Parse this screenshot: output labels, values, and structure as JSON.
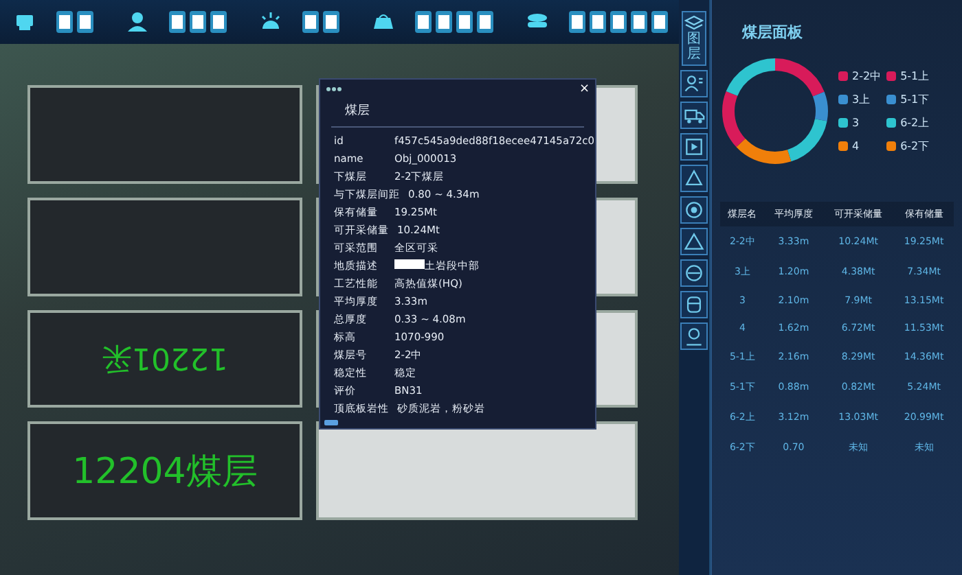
{
  "top_nav": [
    {
      "kind": "monitor"
    },
    {
      "kind": "person"
    },
    {
      "kind": "lamp"
    },
    {
      "kind": "cart"
    },
    {
      "kind": "stack"
    }
  ],
  "scene": {
    "labels": [
      {
        "text": "12204煤层",
        "kind": "large"
      },
      {
        "text": "12201采",
        "kind": "flipped"
      }
    ]
  },
  "side_tabs": {
    "layer_label": "图层"
  },
  "popup": {
    "close": "×",
    "title": "煤层",
    "rows": [
      {
        "key": "id",
        "value": "f457c545a9ded88f18ecee47145a72c0"
      },
      {
        "key": "name",
        "value": "Obj_000013"
      },
      {
        "key": "下煤层",
        "value": "2-2下煤层"
      },
      {
        "key": "与下煤层间距",
        "value": "0.80 ~ 4.34m"
      },
      {
        "key": "保有储量",
        "value": "19.25Mt"
      },
      {
        "key": "可开采储量",
        "value": "10.24Mt"
      },
      {
        "key": "可采范围",
        "value": "全区可采"
      },
      {
        "key": "地质描述",
        "value": "土岩段中部",
        "redacted": true
      },
      {
        "key": "工艺性能",
        "value": "高热值煤(HQ)"
      },
      {
        "key": "平均厚度",
        "value": "3.33m"
      },
      {
        "key": "总厚度",
        "value": "0.33 ~ 4.08m"
      },
      {
        "key": "标高",
        "value": "1070-990"
      },
      {
        "key": "煤层号",
        "value": "2-2中"
      },
      {
        "key": "稳定性",
        "value": "稳定"
      },
      {
        "key": "评价",
        "value": "BN31"
      },
      {
        "key": "顶底板岩性",
        "value": "砂质泥岩，粉砂岩"
      }
    ]
  },
  "panel": {
    "title": "煤层面板",
    "legend": [
      {
        "label": "2-2中",
        "color": "#d81b5a"
      },
      {
        "label": "5-1上",
        "color": "#d81b5a"
      },
      {
        "label": "3上",
        "color": "#3a8fd0"
      },
      {
        "label": "5-1下",
        "color": "#3a8fd0"
      },
      {
        "label": "3",
        "color": "#2ec4cf"
      },
      {
        "label": "6-2上",
        "color": "#2ec4cf"
      },
      {
        "label": "4",
        "color": "#f07f0a"
      },
      {
        "label": "6-2下",
        "color": "#f07f0a"
      }
    ],
    "table": {
      "columns": [
        "煤层名",
        "平均厚度",
        "可开采储量",
        "保有储量"
      ],
      "rows": [
        [
          "2-2中",
          "3.33m",
          "10.24Mt",
          "19.25Mt"
        ],
        [
          "3上",
          "1.20m",
          "4.38Mt",
          "7.34Mt"
        ],
        [
          "3",
          "2.10m",
          "7.9Mt",
          "13.15Mt"
        ],
        [
          "4",
          "1.62m",
          "6.72Mt",
          "11.53Mt"
        ],
        [
          "5-1上",
          "2.16m",
          "8.29Mt",
          "14.36Mt"
        ],
        [
          "5-1下",
          "0.88m",
          "0.82Mt",
          "5.24Mt"
        ],
        [
          "6-2上",
          "3.12m",
          "13.03Mt",
          "20.99Mt"
        ],
        [
          "6-2下",
          "0.70",
          "未知",
          "未知"
        ]
      ]
    }
  }
}
